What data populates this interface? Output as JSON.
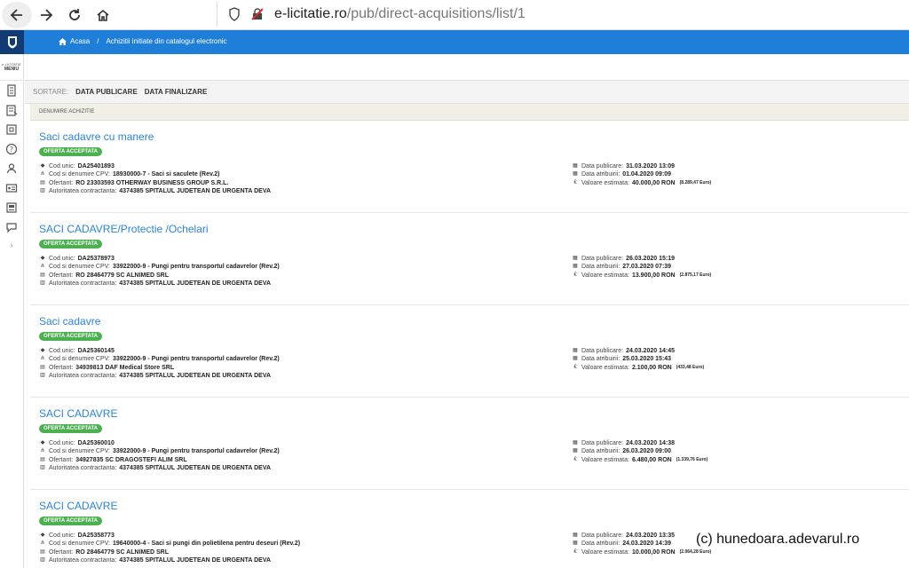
{
  "browser": {
    "url_domain": "e-licitatie.ro",
    "url_path": "/pub/direct-acquisitions/list/1"
  },
  "breadcrumb": {
    "home": "Acasa",
    "separator": "/",
    "current": "Achizitii initiate din catalogul electronic"
  },
  "sidebar": {
    "menu_small": "e-LICITATIE",
    "menu_label": "MENIU",
    "icons": [
      "document-icon",
      "list-icon",
      "shop-icon",
      "help-icon",
      "users-icon",
      "id-card-icon",
      "report-icon",
      "chat-icon"
    ],
    "expand": "›"
  },
  "sort": {
    "label": "SORTARE:",
    "options": [
      "DATA PUBLICARE",
      "DATA FINALIZARE"
    ]
  },
  "column_header": "DENUMIRE ACHIZITIE",
  "labels": {
    "cod_unic": "Cod unic:",
    "cpv": "Cod si denumire CPV:",
    "ofertant": "Ofertant:",
    "autoritate": "Autoritatea contractanta:",
    "data_publicare": "Data publicare:",
    "data_atribuirii": "Data atribuirii:",
    "valoare": "Valoare estimata:"
  },
  "items": [
    {
      "title": "Saci cadavre cu manere",
      "status": "OFERTA ACCEPTATA",
      "cod_unic": "DA25401893",
      "cpv": "18930000-7 - Saci si saculete (Rev.2)",
      "ofertant": "RO 23303593 OTHERWAY BUSINESS GROUP S.R.L.",
      "autoritate": "4374385 SPITALUL JUDETEAN DE URGENTA DEVA",
      "data_publicare": "31.03.2020 13:09",
      "data_atribuirii": "01.04.2020 09:09",
      "valoare": "40.000,00  RON",
      "valoare_euro": "(8.289,47 Euro)"
    },
    {
      "title": "SACI CADAVRE/Protectie /Ochelari",
      "status": "OFERTA ACCEPTATA",
      "cod_unic": "DA25378973",
      "cpv": "33922000-9 - Pungi pentru transportul cadavrelor (Rev.2)",
      "ofertant": "RO 28464779 SC ALNIMED SRL",
      "autoritate": "4374385 SPITALUL JUDETEAN DE URGENTA DEVA",
      "data_publicare": "26.03.2020 15:19",
      "data_atribuirii": "27.03.2020 07:39",
      "valoare": "13.900,00  RON",
      "valoare_euro": "(2.875,17 Euro)"
    },
    {
      "title": "Saci cadavre",
      "status": "OFERTA ACCEPTATA",
      "cod_unic": "DA25360145",
      "cpv": "33922000-9 - Pungi pentru transportul cadavrelor (Rev.2)",
      "ofertant": "34939813 DAF Medical Store SRL",
      "autoritate": "4374385 SPITALUL JUDETEAN DE URGENTA DEVA",
      "data_publicare": "24.03.2020 14:45",
      "data_atribuirii": "25.03.2020 15:43",
      "valoare": "2.100,00  RON",
      "valoare_euro": "(433,48 Euro)"
    },
    {
      "title": "SACI CADAVRE",
      "status": "OFERTA ACCEPTATA",
      "cod_unic": "DA25360010",
      "cpv": "33922000-9 - Pungi pentru transportul cadavrelor (Rev.2)",
      "ofertant": "34927835 SC DRAGOSTEFI ALIM SRL",
      "autoritate": "4374385 SPITALUL JUDETEAN DE URGENTA DEVA",
      "data_publicare": "24.03.2020 14:38",
      "data_atribuirii": "26.03.2020 09:00",
      "valoare": "6.480,00  RON",
      "valoare_euro": "(1.339,76 Euro)"
    },
    {
      "title": "SACI CADAVRE",
      "status": "OFERTA ACCEPTATA",
      "cod_unic": "DA25358773",
      "cpv": "19640000-4 - Saci si pungi din polietilena pentru deseuri (Rev.2)",
      "ofertant": "RO 28464779 SC ALNIMED SRL",
      "autoritate": "4374385 SPITALUL JUDETEAN DE URGENTA DEVA",
      "data_publicare": "24.03.2020 13:35",
      "data_atribuirii": "24.03.2020 14:39",
      "valoare": "10.000,00  RON",
      "valoare_euro": "(2.064,28 Euro)"
    }
  ],
  "watermark": "(c) hunedoara.adevarul.ro",
  "colors": {
    "header_blue": "#1f7fd8",
    "logo_navy": "#123a73",
    "title_link": "#2d84d6",
    "badge_green": "#4caf50"
  }
}
